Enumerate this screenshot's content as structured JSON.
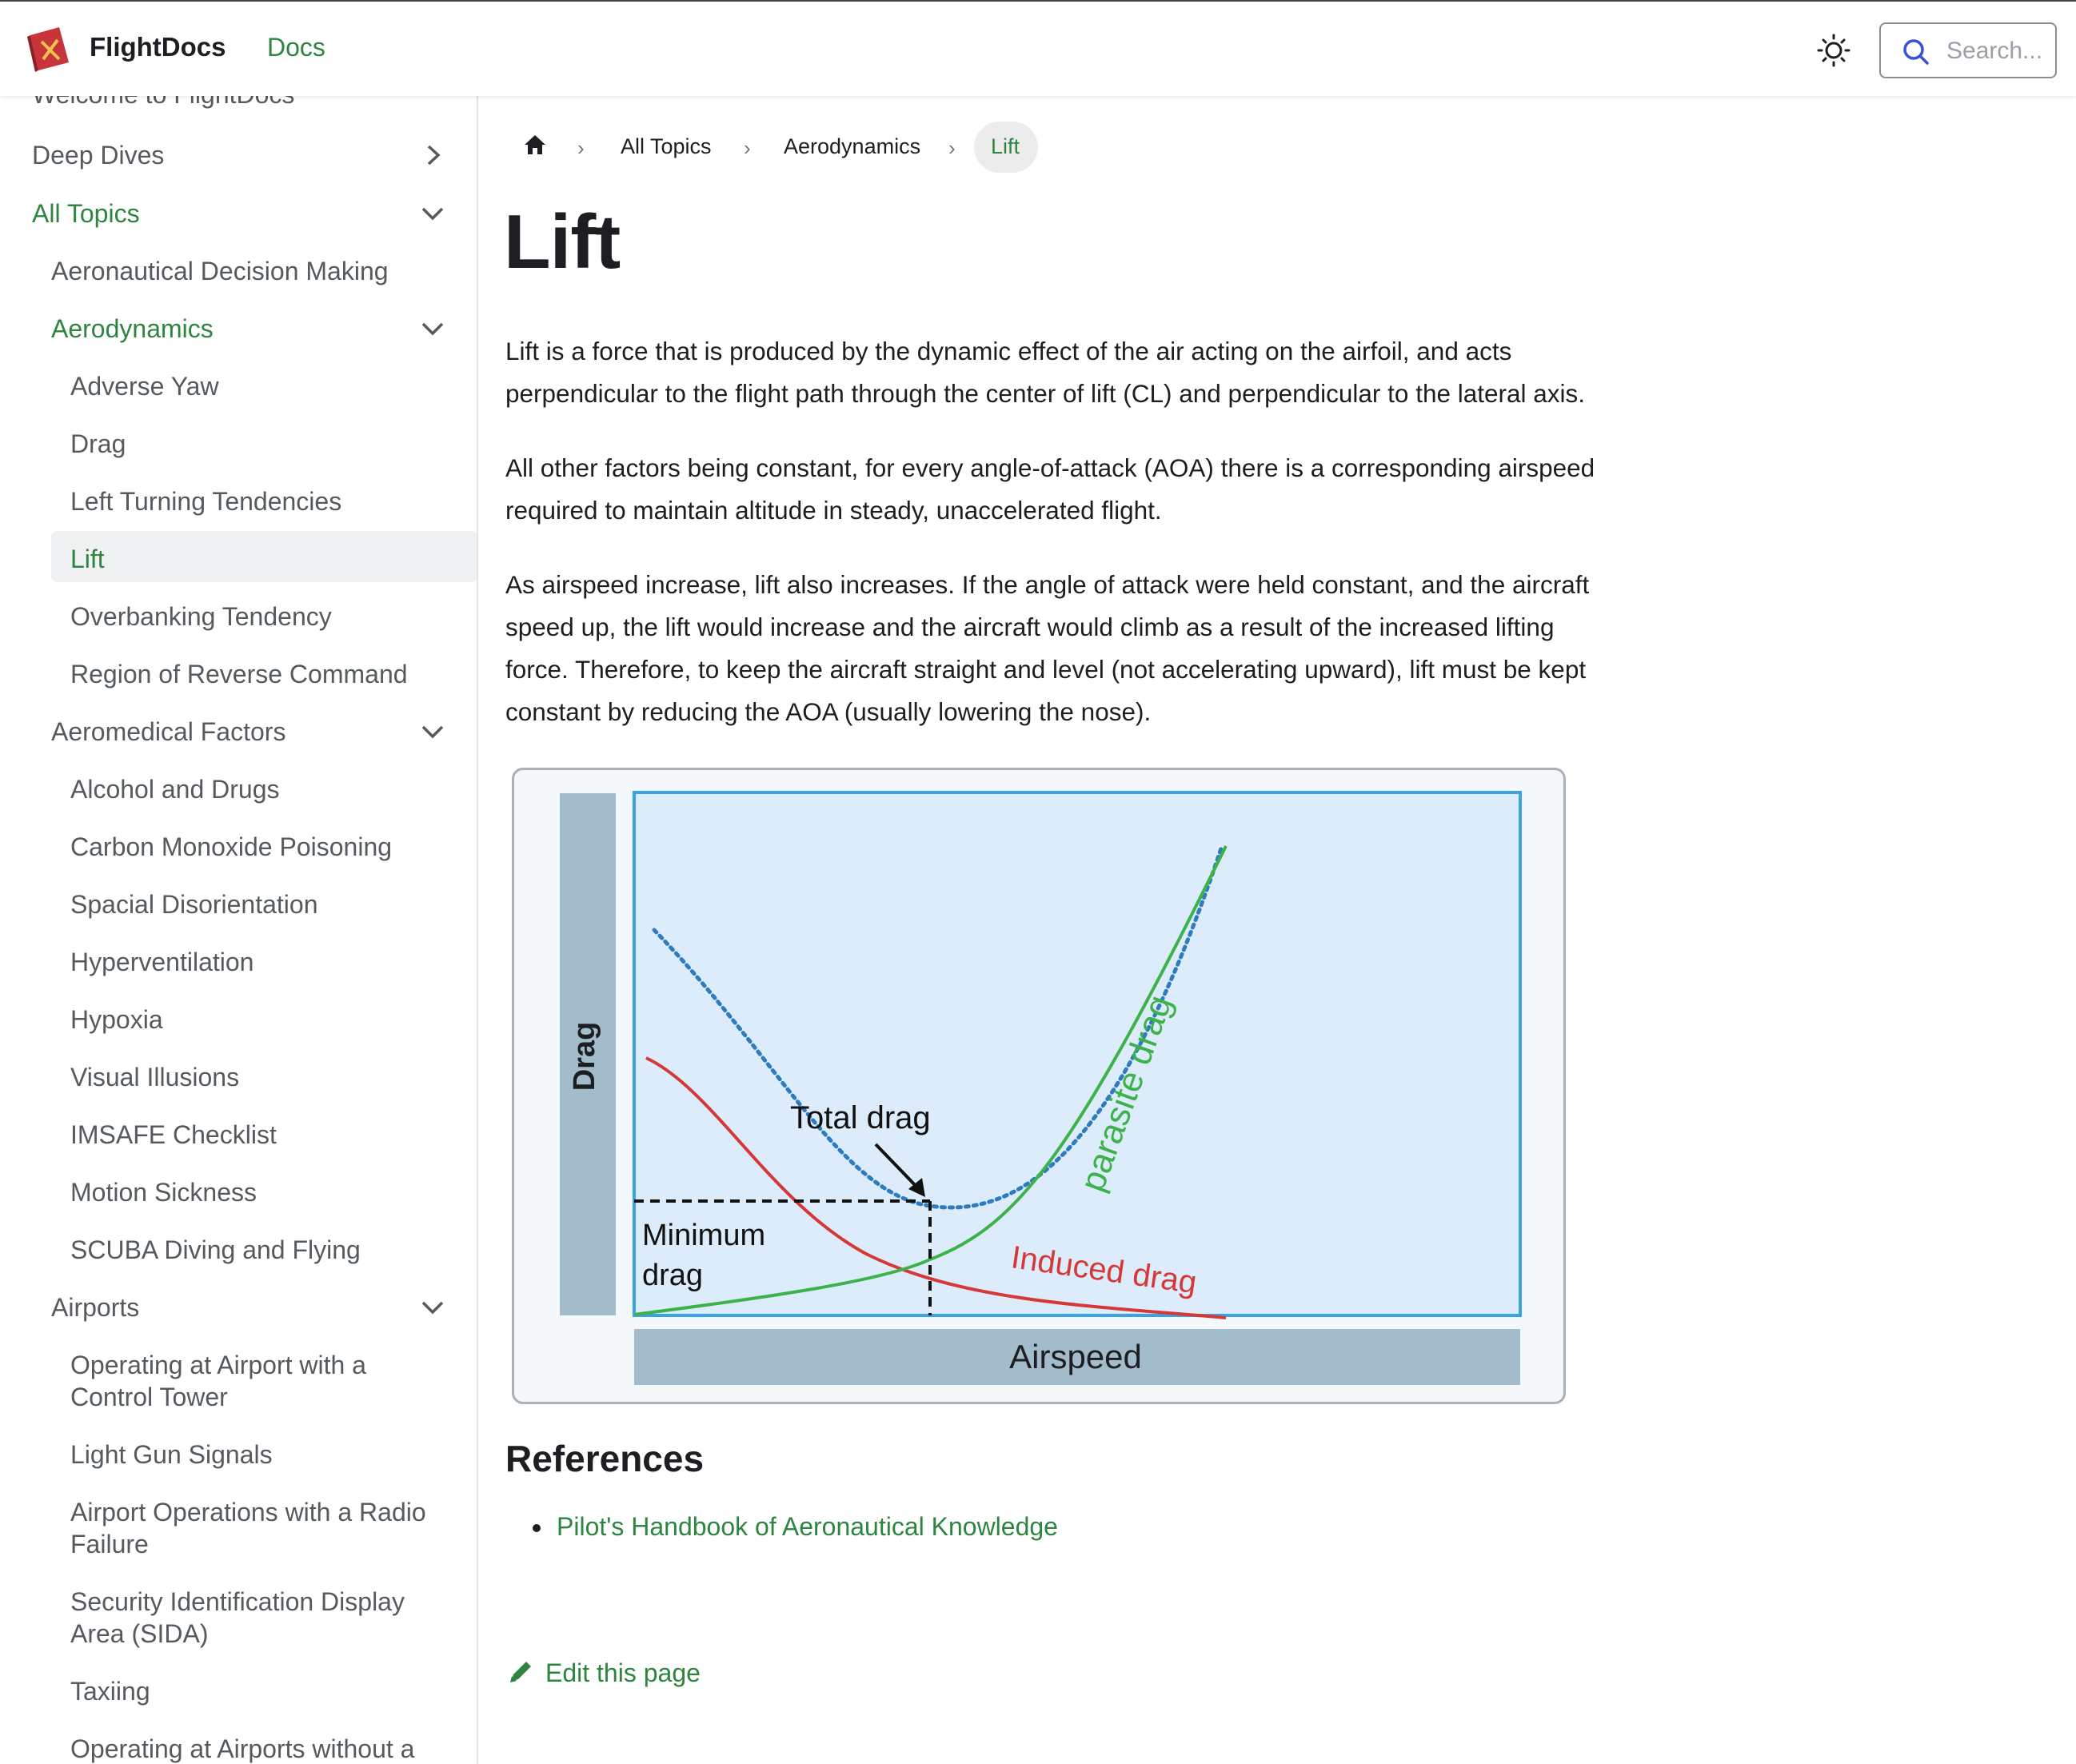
{
  "header": {
    "brand": "FlightDocs",
    "docs_link": "Docs",
    "search_placeholder": "Search..."
  },
  "sidebar": {
    "partial_top": "Welcome to FlightDocs",
    "deep_dives": "Deep Dives",
    "all_topics": "All Topics",
    "adm": "Aeronautical Decision Making",
    "aerodynamics": "Aerodynamics",
    "aero_items": [
      "Adverse Yaw",
      "Drag",
      "Left Turning Tendencies",
      "Lift",
      "Overbanking Tendency",
      "Region of Reverse Command"
    ],
    "aeromedical": "Aeromedical Factors",
    "med_items": [
      "Alcohol and Drugs",
      "Carbon Monoxide Poisoning",
      "Spacial Disorientation",
      "Hyperventilation",
      "Hypoxia",
      "Visual Illusions",
      "IMSAFE Checklist",
      "Motion Sickness",
      "SCUBA Diving and Flying"
    ],
    "airports": "Airports",
    "airport_items": [
      [
        "Operating at Airport with a",
        "Control Tower"
      ],
      [
        "Light Gun Signals"
      ],
      [
        "Airport Operations with a Radio",
        "Failure"
      ],
      [
        "Security Identification Display",
        "Area (SIDA)"
      ],
      [
        "Taxiing"
      ],
      [
        "Operating at Airports without a"
      ]
    ]
  },
  "breadcrumb": {
    "items": [
      "All Topics",
      "Aerodynamics"
    ],
    "current": "Lift"
  },
  "article": {
    "title": "Lift",
    "paragraphs": [
      [
        "Lift is a force that is produced by the dynamic effect of the air acting on the airfoil, and acts",
        "perpendicular to the flight path through the center of lift (CL) and perpendicular to the lateral axis."
      ],
      [
        "All other factors being constant, for every angle-of-attack (AOA) there is a corresponding airspeed",
        "required to maintain altitude in steady, unaccelerated flight."
      ],
      [
        "As airspeed increase, lift also increases. If the angle of attack were held constant, and the aircraft",
        "speed up, the lift would increase and the aircraft would climb as a result of the increased lifting",
        "force. Therefore, to keep the aircraft straight and level (not accelerating upward), lift must be kept",
        "constant by reducing the AOA (usually lowering the nose)."
      ]
    ],
    "references_heading": "References",
    "reference_link": "Pilot's Handbook of Aeronautical Knowledge",
    "edit_link": "Edit this page"
  },
  "figure": {
    "y_label": "Drag",
    "x_label": "Airspeed",
    "total_drag": "Total drag",
    "parasite_drag": "parasite drag",
    "induced_drag": "Induced drag",
    "min_drag_line1": "Minimum",
    "min_drag_line2": "drag"
  },
  "colors": {
    "accent": "#2e8540",
    "induced": "#d63838",
    "parasite": "#3db24b",
    "total": "#2f7bbd",
    "plot_bg": "#dcecfa",
    "axis_band": "#a3bccb"
  }
}
